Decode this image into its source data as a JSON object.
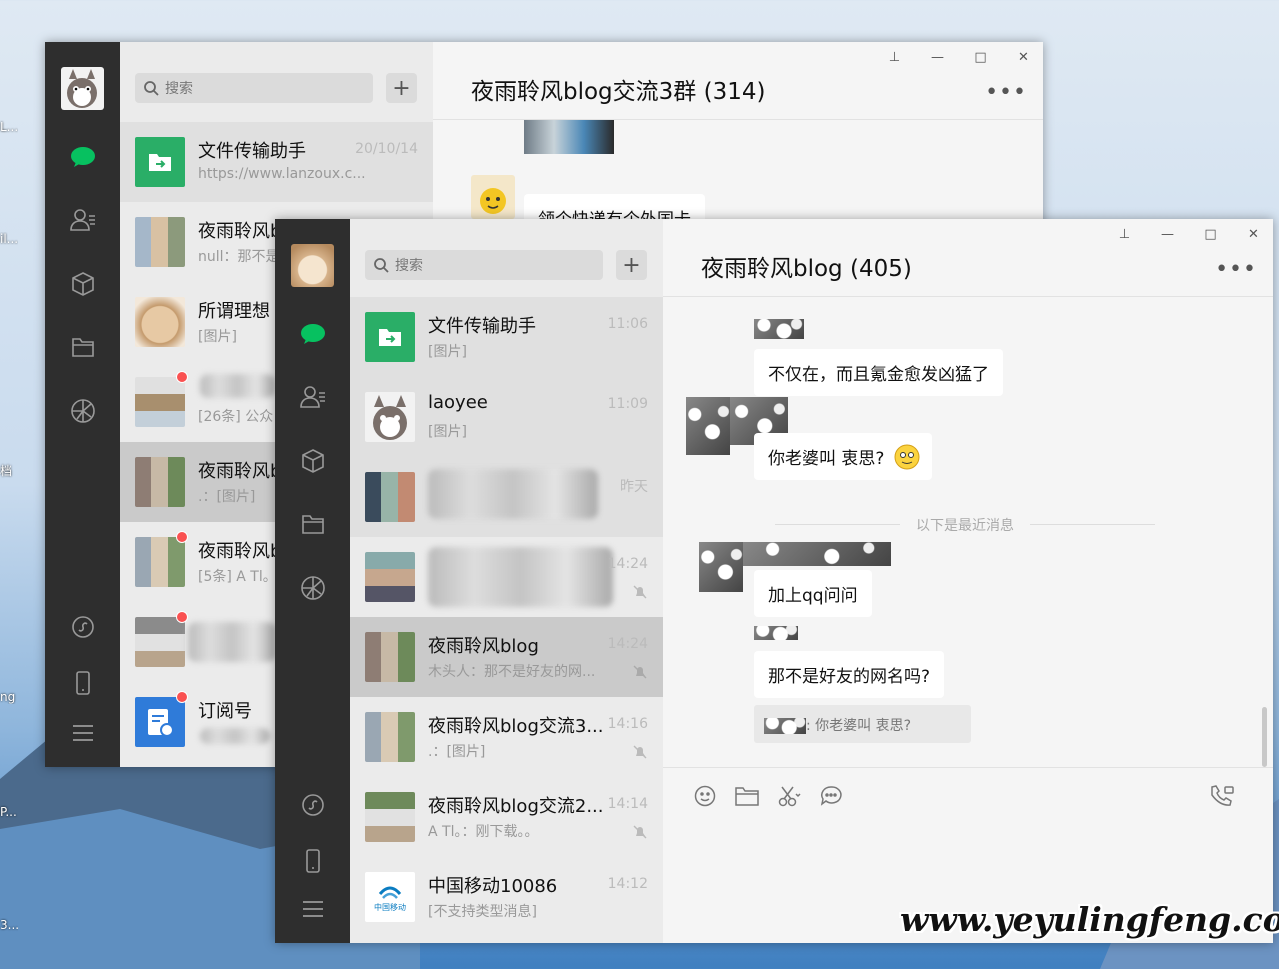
{
  "desktop": {
    "watermark": "www.yeyulingfeng.com",
    "icon_fragments": [
      "L...",
      "il...",
      "档",
      "ng",
      "P...",
      "3..."
    ]
  },
  "back_window": {
    "title": "夜雨聆风blog交流3群 (314)",
    "search_placeholder": "搜索",
    "chat_messages": [
      {
        "text": "领个快递有个外国卡"
      }
    ],
    "sessions": [
      {
        "name": "文件传输助手",
        "preview": "https://www.lanzoux.c...",
        "time": "20/10/14"
      },
      {
        "name": "夜雨聆风b",
        "preview": "null：那不是",
        "time": ""
      },
      {
        "name": "所谓理想",
        "preview": "[图片]",
        "time": ""
      },
      {
        "name": "",
        "preview": "[26条] 公众",
        "time": ""
      },
      {
        "name": "夜雨聆风b",
        "preview": ".：[图片]",
        "time": ""
      },
      {
        "name": "夜雨聆风b",
        "preview": "[5条] A Tl。",
        "time": ""
      },
      {
        "name": "",
        "preview": "",
        "time": ""
      },
      {
        "name": "订阅号",
        "preview": "",
        "time": ""
      }
    ]
  },
  "front_window": {
    "title": "夜雨聆风blog (405)",
    "search_placeholder": "搜索",
    "sessions": [
      {
        "name": "文件传输助手",
        "preview": "[图片]",
        "time": "11:06"
      },
      {
        "name": "laoyee",
        "preview": "[图片]",
        "time": "11:09"
      },
      {
        "name": "",
        "preview": "",
        "time": "昨天"
      },
      {
        "name": "",
        "preview": "",
        "time": "14:24"
      },
      {
        "name": "夜雨聆风blog",
        "preview": "木头人：那不是好友的网...",
        "time": "14:24"
      },
      {
        "name": "夜雨聆风blog交流3...",
        "preview": ".：[图片]",
        "time": "14:16"
      },
      {
        "name": "夜雨聆风blog交流2...",
        "preview": "A Tl。：刚下载。。",
        "time": "14:14"
      },
      {
        "name": "中国移动10086",
        "preview": "[不支持类型消息]",
        "time": "14:12"
      }
    ],
    "messages": [
      {
        "text": "不仅在，而且氪金愈发凶猛了"
      },
      {
        "text": "你老婆叫  衷思?"
      },
      {
        "text": "加上qq问问"
      },
      {
        "text": "那不是好友的网名吗?"
      }
    ],
    "separator": "以下是最近消息",
    "quote": ": 你老婆叫  衷思?",
    "china_mobile_logo": "中国移动"
  },
  "colors": {
    "rail": "#2e2e2e",
    "accent_green": "#07c160",
    "badge_red": "#fa5151",
    "file_helper_green": "#27a745"
  }
}
